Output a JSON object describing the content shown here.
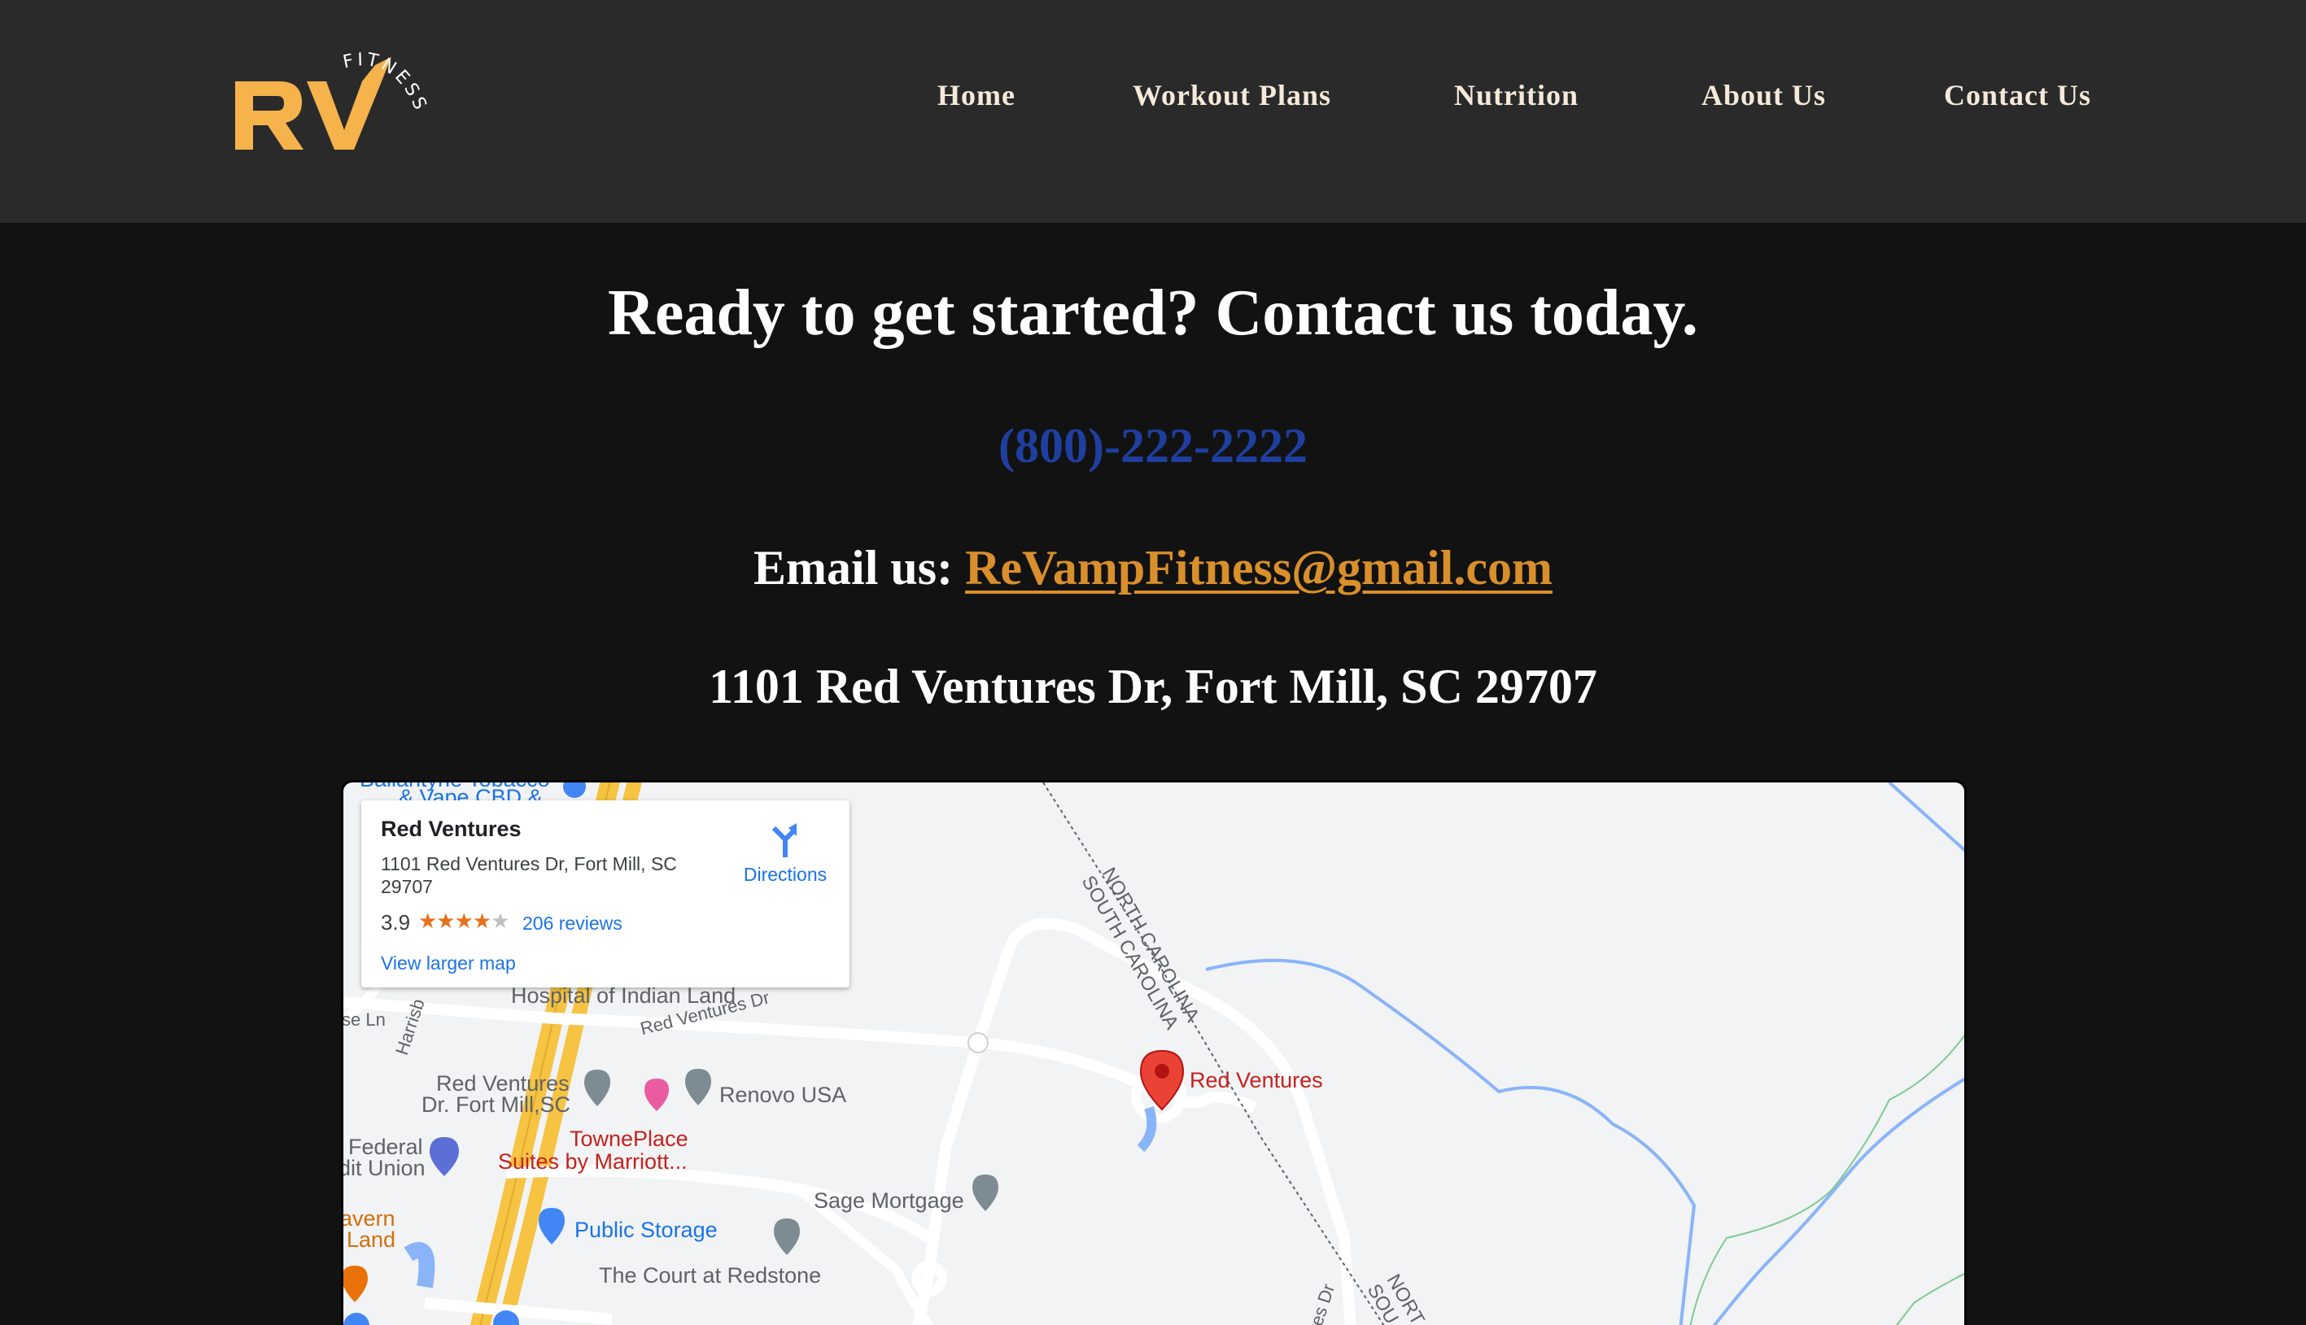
{
  "header": {
    "logo_letters": "RV",
    "logo_tag": "FITNESS",
    "nav": [
      {
        "label": "Home"
      },
      {
        "label": "Workout Plans"
      },
      {
        "label": "Nutrition"
      },
      {
        "label": "About Us"
      },
      {
        "label": "Contact Us"
      }
    ]
  },
  "main": {
    "headline": "Ready to get started? Contact us today.",
    "phone": "(800)-222-2222",
    "email_prefix": "Email us: ",
    "email": "ReVampFitness@gmail.com",
    "address": "1101 Red Ventures Dr, Fort Mill, SC 29707"
  },
  "map": {
    "card": {
      "title": "Red Ventures",
      "address": "1101 Red Ventures Dr, Fort Mill, SC 29707",
      "rating": "3.9",
      "stars": "★★★★",
      "stars_empty": "★",
      "reviews": "206 reviews",
      "larger_map": "View larger map",
      "directions": "Directions"
    },
    "labels": {
      "hospital": "Hospital of Indian Land",
      "red_ventures_dr_road": "Red Ventures Dr",
      "rv_fort_mill_1": "Red Ventures",
      "rv_fort_mill_2": "Dr. Fort Mill,SC",
      "renovo": "Renovo USA",
      "towneplace_1": "TownePlace",
      "towneplace_2": "Suites by Marriott...",
      "federal_1": "Federal",
      "federal_2": "dit Union",
      "tavern_1": "avern",
      "tavern_2": "Land",
      "sage": "Sage Mortgage",
      "public_storage": "Public Storage",
      "court": "The Court at Redstone",
      "pin_label": "Red Ventures",
      "nc": "NORTH CAROLINA",
      "sc": "SOUTH CAROLINA",
      "nc2": "NORT",
      "sc2": "SOU",
      "harris": "Harrisb",
      "se_ln": "se Ln",
      "res_dr": "res Dr",
      "top_clip_1": "Ballantyne Tobacco",
      "top_clip_2": "& Vape CBD &"
    },
    "colors": {
      "land": "#f1f3f4",
      "road": "#ffffff",
      "highway": "#f6c342",
      "water": "#8ab4f8",
      "pin": "#ea4335"
    }
  },
  "colors": {
    "header_bg": "#2a2a2b",
    "page_bg": "#121212",
    "accent": "#f6b24b",
    "phone": "#1f3fa0",
    "email": "#d98f2b"
  }
}
